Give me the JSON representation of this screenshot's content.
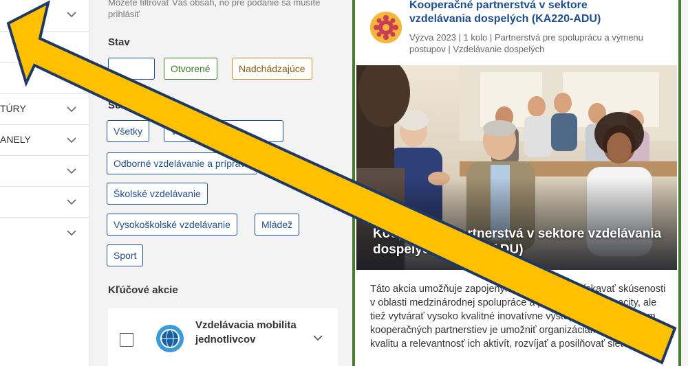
{
  "nav": {
    "items": [
      {
        "label": ""
      },
      {
        "label": ""
      },
      {
        "label": ""
      },
      {
        "label": "TÚRY"
      },
      {
        "label": "ANELY"
      },
      {
        "label": ""
      },
      {
        "label": ""
      },
      {
        "label": ""
      }
    ]
  },
  "filters": {
    "hint": "Môžete filtrovať Váš obsah, no pre podanie sa musíte prihlásiť",
    "status_title": "Stav",
    "status_chips": [
      "Otvorené",
      "Nadchádzajúce"
    ],
    "sectors_title": "Sektory",
    "sector_chips": [
      "Všetky",
      "Vzdel",
      "Odborné vzdelávanie a príprava",
      "Školské vzdelávanie",
      "Vysokoškolské vzdelávanie",
      "Mládež",
      "Sport"
    ],
    "key_actions_title": "Kľúčové akcie",
    "key_action": {
      "label": "Vzdelávacia mobilita jednotlivcov"
    }
  },
  "card": {
    "title": "Kooperačné partnerstvá v sektore vzdelávania dospelých (KA220-ADU)",
    "meta": "Výzva 2023 | 1 kolo | Partnerstvá pre spoluprácu a výmenu postupov | Vzdelávanie dospelých",
    "image_title": "Kooperačné partnerstvá v sektore vzdelávania dospelých (KA220-ADU)",
    "body": "Táto akcia umožňuje zapojeným organizáciám získavať skúsenosti v oblasti medzinárodnej spolupráce a posilňovať ich kapacity, ale tiež vytvárať vysoko kvalitné inovatívne výstupy. Hlavným cieľom kooperačných partnerstiev je umožniť organizáciám zvyšovať kvalitu a relevantnosť ich aktivít, rozvíjať a posilňovať siete"
  },
  "colors": {
    "primary_blue": "#1f4e8c",
    "open_green": "#3d7a2a",
    "upcoming_orange": "#c98a2a",
    "card_border": "#4b7a32",
    "arrow_yellow": "#ffc000",
    "arrow_outline": "#1f3864"
  },
  "icons": [
    "chevron-down-icon",
    "globe-icon",
    "erasmus-logo-icon",
    "pointer-arrow"
  ]
}
